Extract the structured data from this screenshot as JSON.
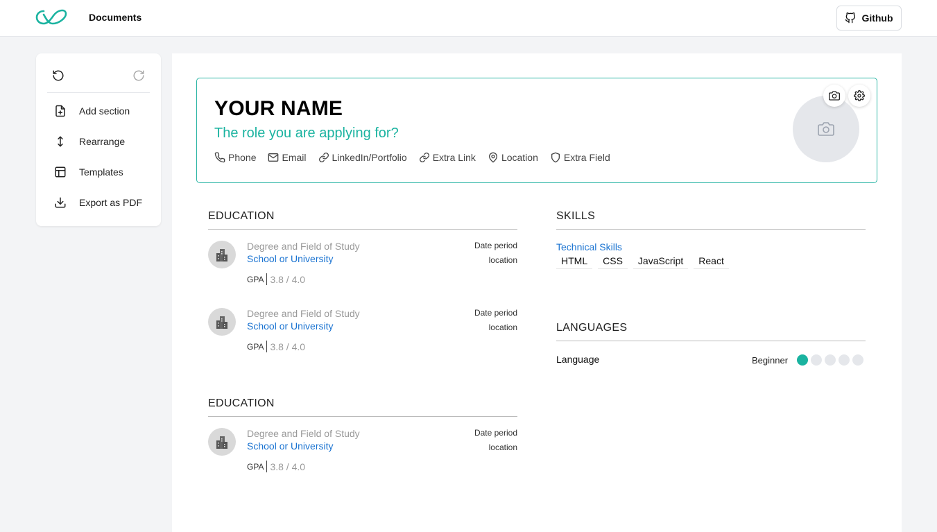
{
  "colors": {
    "accent": "#1ab3a0",
    "link": "#1a73d1",
    "page_bg": "#f3f4f6"
  },
  "header": {
    "nav_documents": "Documents",
    "github_label": "Github"
  },
  "sidebar": {
    "items": [
      {
        "label": "Add section",
        "icon": "file-plus-icon"
      },
      {
        "label": "Rearrange",
        "icon": "arrows-vertical-icon"
      },
      {
        "label": "Templates",
        "icon": "layout-icon"
      },
      {
        "label": "Export as PDF",
        "icon": "download-icon"
      }
    ]
  },
  "resume": {
    "name": "YOUR NAME",
    "role": "The role you are applying for?",
    "contacts": [
      {
        "label": "Phone",
        "icon": "phone-icon"
      },
      {
        "label": "Email",
        "icon": "mail-icon"
      },
      {
        "label": "LinkedIn/Portfolio",
        "icon": "link-icon"
      },
      {
        "label": "Extra Link",
        "icon": "link-icon"
      },
      {
        "label": "Location",
        "icon": "map-pin-icon"
      },
      {
        "label": "Extra Field",
        "icon": "shield-icon"
      }
    ],
    "education_title": "EDUCATION",
    "education_title_2": "EDUCATION",
    "education": [
      {
        "degree": "Degree and Field of Study",
        "school": "School or University",
        "gpa_label": "GPA",
        "gpa": "3.8 / 4.0",
        "date": "Date period",
        "location": "location"
      },
      {
        "degree": "Degree and Field of Study",
        "school": "School or University",
        "gpa_label": "GPA",
        "gpa": "3.8 / 4.0",
        "date": "Date period",
        "location": "location"
      }
    ],
    "education_2": [
      {
        "degree": "Degree and Field of Study",
        "school": "School or University",
        "gpa_label": "GPA",
        "gpa": "3.8 / 4.0",
        "date": "Date period",
        "location": "location"
      }
    ],
    "skills_title": "SKILLS",
    "skills_subtitle": "Technical Skills",
    "skills": [
      "HTML",
      "CSS",
      "JavaScript",
      "React"
    ],
    "languages_title": "LANGUAGES",
    "language": {
      "name": "Language",
      "level": "Beginner",
      "rating": 1,
      "max": 5
    }
  }
}
